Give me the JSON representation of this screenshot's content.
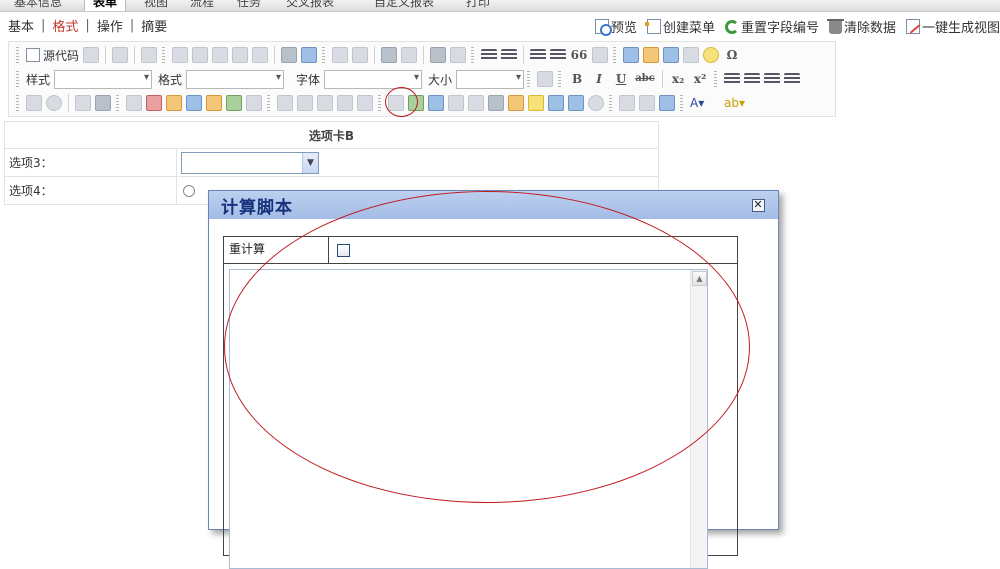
{
  "top_tabs": [
    "基本信息",
    "表单",
    "视图",
    "流程",
    "任务",
    "交叉报表",
    "自定义报表",
    "打印"
  ],
  "top_tab_active": "表单",
  "submenu": [
    {
      "label": "基本",
      "active": false
    },
    {
      "label": "格式",
      "active": true
    },
    {
      "label": "操作",
      "active": false
    },
    {
      "label": "摘要",
      "active": false
    }
  ],
  "actions": {
    "preview": "预览",
    "create_menu": "创建菜单",
    "reset_field_no": "重置字段编号",
    "clear_data": "清除数据",
    "generate_view": "一键生成视图"
  },
  "toolbar": {
    "source_label": "源代码",
    "style_label": "样式",
    "format_label": "格式",
    "font_label": "字体",
    "size_label": "大小",
    "bold": "B",
    "italic": "I",
    "underline": "U",
    "strike": "abc",
    "subscript": "x₂",
    "superscript": "x²",
    "omega": "Ω",
    "quote": "66"
  },
  "form": {
    "header": "选项卡B",
    "rows": [
      {
        "label": "选项3：",
        "control": "select"
      },
      {
        "label": "选项4：",
        "control": "radio"
      }
    ]
  },
  "dialog": {
    "title": "计算脚本",
    "close_symbol": "✕",
    "recalc_label": "重计算",
    "script_value": "",
    "scroll_up": "▲"
  },
  "colors": {
    "accent_red": "#c0392b",
    "annotation_red": "#c0181f",
    "dialog_title_text": "#15327a"
  }
}
